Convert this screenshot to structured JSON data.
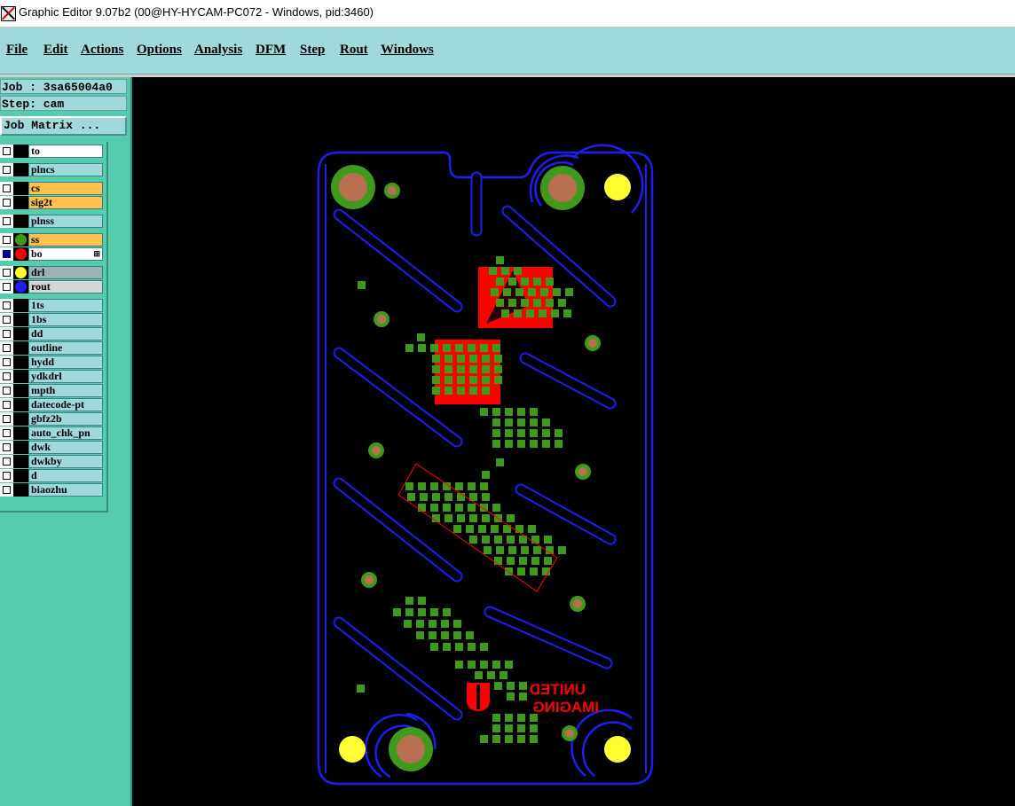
{
  "window": {
    "title": "Graphic Editor 9.07b2 (00@HY-HYCAM-PC072 - Windows, pid:3460)",
    "app_icon": "graphic-editor-icon"
  },
  "menu": [
    "File",
    "Edit",
    "Actions",
    "Options",
    "Analysis",
    "DFM",
    "Step",
    "Rout",
    "Windows"
  ],
  "job": {
    "label": "Job : 3sa65004a0",
    "step": "Step: cam",
    "matrix_button": "Job Matrix ..."
  },
  "colors": {
    "panel_bg": "#56ccaf",
    "menu_bg": "#9fd9d9",
    "layer_default": "#9fd9d9",
    "layer_affected": "#ffc04c",
    "layer_work": "#ffffff",
    "layer_displayed": "#9ab3b3",
    "rout_outline": "#1e1ef0",
    "solder_pad": "#3f9a1c",
    "mask_copper": "#ff0000",
    "hole": "#ffff33",
    "drill_center": "#b87050",
    "canvas_bg": "#000000"
  },
  "layers": [
    {
      "name": "to",
      "bg": "#ffffff",
      "dot": "",
      "active": false
    },
    {
      "name": "plncs",
      "bg": "#9fd9d9",
      "dot": "",
      "active": false
    },
    {
      "name": "cs",
      "bg": "#ffc04c",
      "dot": "",
      "active": false
    },
    {
      "name": "sig2t",
      "bg": "#ffc04c",
      "dot": "",
      "active": false
    },
    {
      "name": "plnss",
      "bg": "#9fd9d9",
      "dot": "",
      "active": false
    },
    {
      "name": "ss",
      "bg": "#ffc04c",
      "dot": "#3f9a1c",
      "active": false
    },
    {
      "name": "bo",
      "bg": "#ffffff",
      "dot": "#ff0000",
      "active": true,
      "mark": "⊞"
    },
    {
      "name": "drl",
      "bg": "#9ab3b3",
      "dot": "#ffff33",
      "active": false
    },
    {
      "name": "rout",
      "bg": "#d6d6d6",
      "dot": "#1e1ef0",
      "active": false
    },
    {
      "name": "1ts",
      "bg": "#9fd9d9",
      "dot": "",
      "active": false
    },
    {
      "name": "1bs",
      "bg": "#9fd9d9",
      "dot": "",
      "active": false
    },
    {
      "name": "dd",
      "bg": "#9fd9d9",
      "dot": "",
      "active": false
    },
    {
      "name": "outline",
      "bg": "#9fd9d9",
      "dot": "",
      "active": false
    },
    {
      "name": "hydd",
      "bg": "#9fd9d9",
      "dot": "",
      "active": false
    },
    {
      "name": "ydkdrl",
      "bg": "#9fd9d9",
      "dot": "",
      "active": false
    },
    {
      "name": "mpth",
      "bg": "#9fd9d9",
      "dot": "",
      "active": false
    },
    {
      "name": "datecode-pt",
      "bg": "#9fd9d9",
      "dot": "",
      "active": false
    },
    {
      "name": "gbfz2b",
      "bg": "#9fd9d9",
      "dot": "",
      "active": false
    },
    {
      "name": "auto_chk_pn",
      "bg": "#9fd9d9",
      "dot": "",
      "active": false
    },
    {
      "name": "dwk",
      "bg": "#9fd9d9",
      "dot": "",
      "active": false
    },
    {
      "name": "dwkby",
      "bg": "#9fd9d9",
      "dot": "",
      "active": false
    },
    {
      "name": "d",
      "bg": "#9fd9d9",
      "dot": "",
      "active": false
    },
    {
      "name": "biaozhu",
      "bg": "#9fd9d9",
      "dot": "",
      "active": false
    }
  ],
  "board": {
    "logo_text_line1": "UNITED",
    "logo_text_line2": "IMAGING"
  }
}
